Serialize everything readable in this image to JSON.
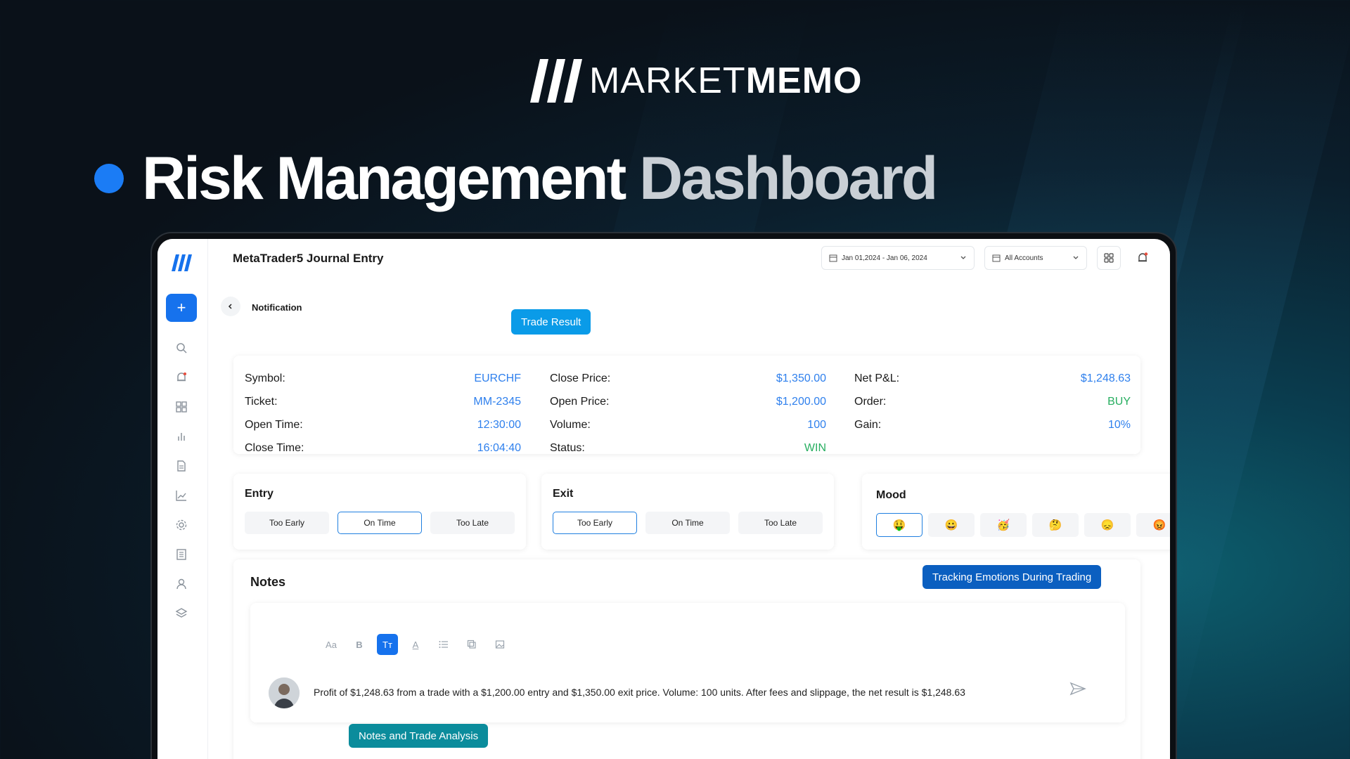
{
  "brand": {
    "light": "MARKET",
    "bold": "MEMO"
  },
  "hero": {
    "title_main": "Risk Management",
    "title_fade": "Dashboard"
  },
  "app": {
    "title": "MetaTrader5 Journal Entry",
    "date_range": "Jan 01,2024 - Jan 06, 2024",
    "account": "All Accounts",
    "breadcrumb": "Notification",
    "add_label": "+"
  },
  "sidebar": {
    "items": [
      "search-icon",
      "bell-icon",
      "grid-icon",
      "bar-chart-icon",
      "document-icon",
      "line-chart-icon",
      "gear-icon",
      "newspaper-icon",
      "user-icon",
      "layers-icon"
    ]
  },
  "trade": {
    "col1": [
      {
        "k": "Symbol:",
        "v": "EURCHF"
      },
      {
        "k": "Ticket:",
        "v": "MM-2345"
      },
      {
        "k": "Open Time:",
        "v": "12:30:00"
      },
      {
        "k": "Close Time:",
        "v": "16:04:40"
      }
    ],
    "col2": [
      {
        "k": "Close Price:",
        "v": "$1,350.00"
      },
      {
        "k": "Open Price:",
        "v": "$1,200.00"
      },
      {
        "k": "Volume:",
        "v": "100"
      },
      {
        "k": "Status:",
        "v": "WIN"
      }
    ],
    "col3": [
      {
        "k": "Net P&L:",
        "v": "$1,248.63"
      },
      {
        "k": "Order:",
        "v": "BUY"
      },
      {
        "k": "Gain:",
        "v": "10%"
      }
    ]
  },
  "entry": {
    "title": "Entry",
    "options": [
      "Too Early",
      "On Time",
      "Too Late"
    ],
    "selected": "On Time"
  },
  "exit": {
    "title": "Exit",
    "options": [
      "Too Early",
      "On Time",
      "Too Late"
    ],
    "selected": "Too Early"
  },
  "mood": {
    "title": "Mood",
    "options": [
      "🤑",
      "😀",
      "🥳",
      "🤔",
      "😞",
      "😡"
    ],
    "selected_index": 0
  },
  "notes": {
    "title": "Notes",
    "toolbar": [
      "Aa",
      "B",
      "Tт",
      "A",
      "list-icon",
      "copy-icon",
      "image-icon"
    ],
    "text": "Profit of $1,248.63 from a trade with a $1,200.00 entry and $1,350.00 exit price. Volume: 100 units. After fees and slippage, the net result is $1,248.63"
  },
  "callouts": {
    "trade_result": "Trade Result",
    "tracking": "Tracking Emotions During Trading",
    "notes": "Notes and Trade Analysis"
  },
  "colors": {
    "accent": "#1672ed",
    "value_blue": "#2f80ed",
    "value_green": "#27ae60",
    "callout_blue": "#0a8fe0",
    "callout_navy": "#0b5fc0",
    "callout_teal": "#0b8c9c"
  }
}
